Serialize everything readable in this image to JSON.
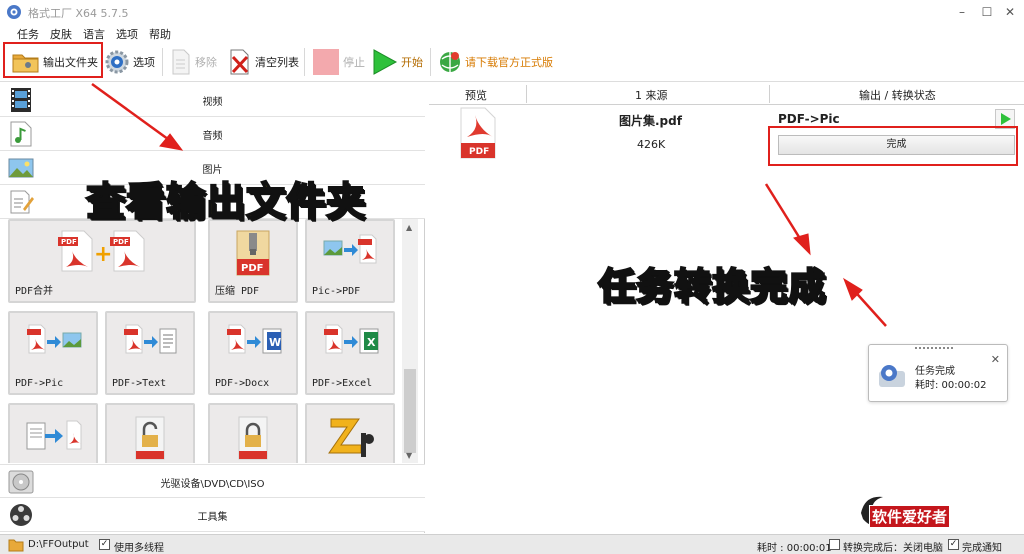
{
  "window": {
    "title": "格式工厂 X64 5.7.5"
  },
  "menu": [
    "任务",
    "皮肤",
    "语言",
    "选项",
    "帮助"
  ],
  "toolbar": {
    "output_folder": "输出文件夹",
    "options": "选项",
    "remove": "移除",
    "clear_list": "清空列表",
    "stop": "停止",
    "start": "开始",
    "download": "请下载官方正式版"
  },
  "categories": {
    "video": "视频",
    "audio": "音频",
    "picture": "图片",
    "optical": "光驱设备\\DVD\\CD\\ISO",
    "tools": "工具集"
  },
  "tools": [
    "PDF合并",
    "压缩 PDF",
    "Pic->PDF",
    "PDF->Pic",
    "PDF->Text",
    "PDF->Docx",
    "PDF->Excel"
  ],
  "tasklist": {
    "col_preview": "预览",
    "col_source": "1 来源",
    "col_status": "输出 / 转换状态",
    "row": {
      "filename": "图片集.pdf",
      "size": "426K",
      "conversion": "PDF->Pic",
      "status": "完成",
      "icon_label": "PDF"
    }
  },
  "toast": {
    "title": "任务完成",
    "elapsed": "耗时: 00:00:02"
  },
  "statusbar": {
    "output_path": "D:\\FFOutput",
    "multithread": "使用多线程",
    "elapsed": "耗时 : 00:00:01",
    "after_convert": "转换完成后：关闭电脑",
    "notify": "完成通知"
  },
  "annotations": {
    "view_output": "查看输出文件夹",
    "task_done": "任务转换完成"
  },
  "watermark": {
    "text": "软件爱好者"
  },
  "colors": {
    "accent": "#e0201c",
    "callout": "#fff200",
    "pdf_red": "#d9342b"
  }
}
